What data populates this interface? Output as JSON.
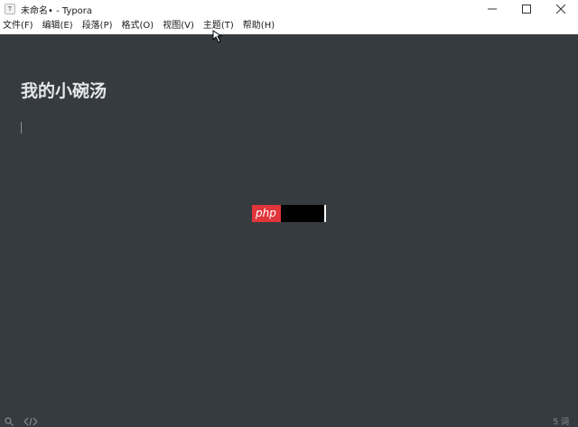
{
  "window": {
    "title": "未命名• - Typora",
    "app_icon_glyph": "T",
    "controls": [
      "minimize-icon",
      "maximize-icon",
      "close-icon"
    ]
  },
  "menubar": {
    "items": [
      {
        "label": "文件(F)"
      },
      {
        "label": "编辑(E)"
      },
      {
        "label": "段落(P)"
      },
      {
        "label": "格式(O)"
      },
      {
        "label": "视图(V)"
      },
      {
        "label": "主题(T)"
      },
      {
        "label": "帮助(H)"
      }
    ]
  },
  "editor": {
    "heading": "我的小碗汤",
    "background": "#363b40",
    "text_color": "#e6e6e6"
  },
  "watermark": {
    "text": "php",
    "accent": "#e0353b"
  },
  "statusbar": {
    "left_icons": [
      "search-icon",
      "source-code-icon"
    ],
    "word_count": "5 词"
  }
}
